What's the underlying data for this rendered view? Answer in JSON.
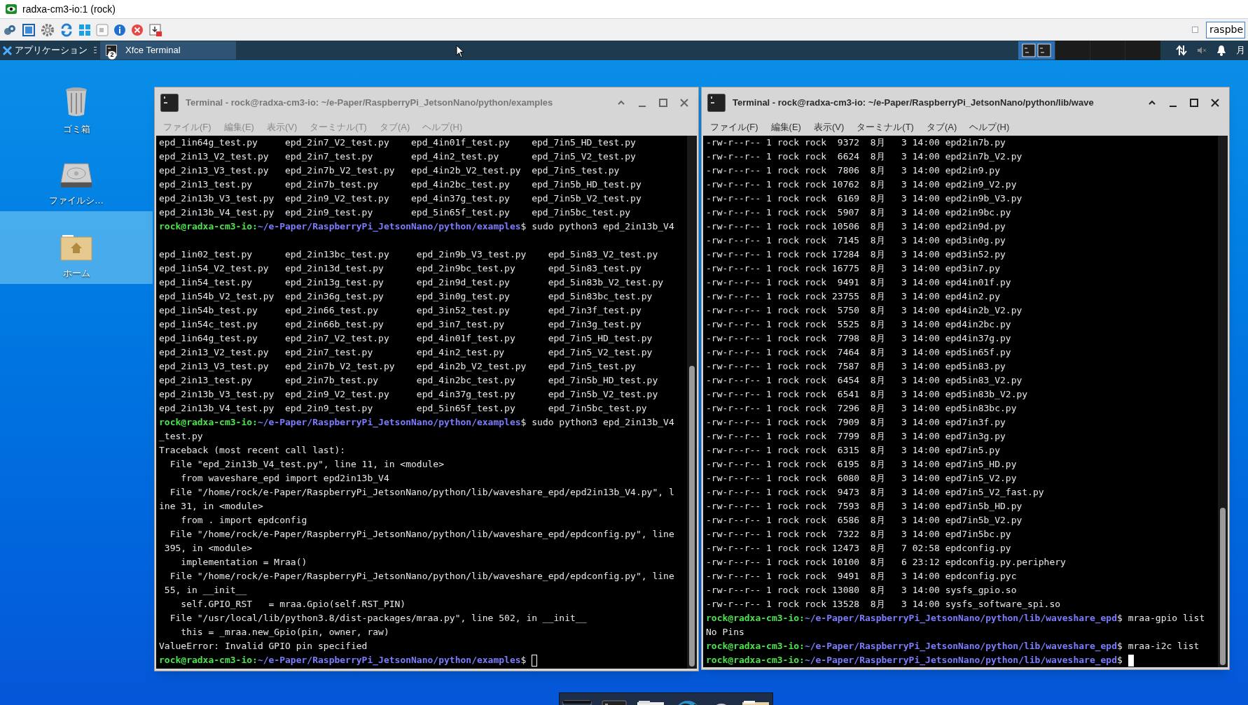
{
  "app_window": {
    "title": "radxa-cm3-io:1 (rock)"
  },
  "toolbar": {
    "field_value": "raspbe"
  },
  "panel": {
    "menu_label": "アプリケーション",
    "task": {
      "label": "Xfce Terminal",
      "badge": "2"
    },
    "clock": "月"
  },
  "desktop_icons": [
    {
      "label": "ゴミ箱",
      "kind": "trash",
      "selected": false
    },
    {
      "label": "ファイルシ…",
      "kind": "drive",
      "selected": false
    },
    {
      "label": "ホーム",
      "kind": "home",
      "selected": true
    }
  ],
  "terminals": [
    {
      "title": "Terminal - rock@radxa-cm3-io: ~/e-Paper/RaspberryPi_JetsonNano/python/examples",
      "active": false,
      "menu": [
        "ファイル(F)",
        "編集(E)",
        "表示(V)",
        "ターミナル(T)",
        "タブ(A)",
        "ヘルプ(H)"
      ],
      "lines": [
        "epd_1in64g_test.py     epd_2in7_V2_test.py    epd_4in01f_test.py    epd_7in5_HD_test.py",
        "epd_2in13_V2_test.py   epd_2in7_test.py       epd_4in2_test.py      epd_7in5_V2_test.py",
        "epd_2in13_V3_test.py   epd_2in7b_V2_test.py   epd_4in2b_V2_test.py  epd_7in5_test.py",
        "epd_2in13_test.py      epd_2in7b_test.py      epd_4in2bc_test.py    epd_7in5b_HD_test.py",
        "epd_2in13b_V3_test.py  epd_2in9_V2_test.py    epd_4in37g_test.py    epd_7in5b_V2_test.py",
        "epd_2in13b_V4_test.py  epd_2in9_test.py       epd_5in65f_test.py    epd_7in5bc_test.py",
        {
          "kind": "prompt",
          "user": "rock@radxa-cm3-io:",
          "path": "~/e-Paper/RaspberryPi_JetsonNano/python/examples",
          "command": "$ sudo python3 epd_2in13b_V4",
          "cursor": false
        },
        {
          "kind": "blank"
        },
        "epd_1in02_test.py      epd_2in13bc_test.py     epd_2in9b_V3_test.py    epd_5in83_V2_test.py",
        "epd_1in54_V2_test.py   epd_2in13d_test.py      epd_2in9bc_test.py      epd_5in83_test.py",
        "epd_1in54_test.py      epd_2in13g_test.py      epd_2in9d_test.py       epd_5in83b_V2_test.py",
        "epd_1in54b_V2_test.py  epd_2in36g_test.py      epd_3in0g_test.py       epd_5in83bc_test.py",
        "epd_1in54b_test.py     epd_2in66_test.py       epd_3in52_test.py       epd_7in3f_test.py",
        "epd_1in54c_test.py     epd_2in66b_test.py      epd_3in7_test.py        epd_7in3g_test.py",
        "epd_1in64g_test.py     epd_2in7_V2_test.py     epd_4in01f_test.py      epd_7in5_HD_test.py",
        "epd_2in13_V2_test.py   epd_2in7_test.py        epd_4in2_test.py        epd_7in5_V2_test.py",
        "epd_2in13_V3_test.py   epd_2in7b_V2_test.py    epd_4in2b_V2_test.py    epd_7in5_test.py",
        "epd_2in13_test.py      epd_2in7b_test.py       epd_4in2bc_test.py      epd_7in5b_HD_test.py",
        "epd_2in13b_V3_test.py  epd_2in9_V2_test.py     epd_4in37g_test.py      epd_7in5b_V2_test.py",
        "epd_2in13b_V4_test.py  epd_2in9_test.py        epd_5in65f_test.py      epd_7in5bc_test.py",
        {
          "kind": "prompt",
          "user": "rock@radxa-cm3-io:",
          "path": "~/e-Paper/RaspberryPi_JetsonNano/python/examples",
          "command": "$ sudo python3 epd_2in13b_V4",
          "cursor": false
        },
        "_test.py",
        "Traceback (most recent call last):",
        "  File \"epd_2in13b_V4_test.py\", line 11, in <module>",
        "    from waveshare_epd import epd2in13b_V4",
        "  File \"/home/rock/e-Paper/RaspberryPi_JetsonNano/python/lib/waveshare_epd/epd2in13b_V4.py\", l",
        "ine 31, in <module>",
        "    from . import epdconfig",
        "  File \"/home/rock/e-Paper/RaspberryPi_JetsonNano/python/lib/waveshare_epd/epdconfig.py\", line",
        " 395, in <module>",
        "    implementation = Mraa()",
        "  File \"/home/rock/e-Paper/RaspberryPi_JetsonNano/python/lib/waveshare_epd/epdconfig.py\", line",
        " 55, in __init__",
        "    self.GPIO_RST   = mraa.Gpio(self.RST_PIN)",
        "  File \"/usr/local/lib/python3.8/dist-packages/mraa.py\", line 502, in __init__",
        "    this = _mraa.new_Gpio(pin, owner, raw)",
        "ValueError: Invalid GPIO pin specified",
        {
          "kind": "prompt",
          "user": "rock@radxa-cm3-io:",
          "path": "~/e-Paper/RaspberryPi_JetsonNano/python/examples",
          "command": "$ ",
          "cursor": true
        }
      ]
    },
    {
      "title": "Terminal - rock@radxa-cm3-io: ~/e-Paper/RaspberryPi_JetsonNano/python/lib/wave",
      "active": true,
      "menu": [
        "ファイル(F)",
        "編集(E)",
        "表示(V)",
        "ターミナル(T)",
        "タブ(A)",
        "ヘルプ(H)"
      ],
      "lines": [
        "-rw-r--r-- 1 rock rock  9372  8月   3 14:00 epd2in7b.py",
        "-rw-r--r-- 1 rock rock  6624  8月   3 14:00 epd2in7b_V2.py",
        "-rw-r--r-- 1 rock rock  7806  8月   3 14:00 epd2in9.py",
        "-rw-r--r-- 1 rock rock 10762  8月   3 14:00 epd2in9_V2.py",
        "-rw-r--r-- 1 rock rock  6169  8月   3 14:00 epd2in9b_V3.py",
        "-rw-r--r-- 1 rock rock  5907  8月   3 14:00 epd2in9bc.py",
        "-rw-r--r-- 1 rock rock 10506  8月   3 14:00 epd2in9d.py",
        "-rw-r--r-- 1 rock rock  7145  8月   3 14:00 epd3in0g.py",
        "-rw-r--r-- 1 rock rock 17284  8月   3 14:00 epd3in52.py",
        "-rw-r--r-- 1 rock rock 16775  8月   3 14:00 epd3in7.py",
        "-rw-r--r-- 1 rock rock  9491  8月   3 14:00 epd4in01f.py",
        "-rw-r--r-- 1 rock rock 23755  8月   3 14:00 epd4in2.py",
        "-rw-r--r-- 1 rock rock  5750  8月   3 14:00 epd4in2b_V2.py",
        "-rw-r--r-- 1 rock rock  5525  8月   3 14:00 epd4in2bc.py",
        "-rw-r--r-- 1 rock rock  7798  8月   3 14:00 epd4in37g.py",
        "-rw-r--r-- 1 rock rock  7464  8月   3 14:00 epd5in65f.py",
        "-rw-r--r-- 1 rock rock  7587  8月   3 14:00 epd5in83.py",
        "-rw-r--r-- 1 rock rock  6454  8月   3 14:00 epd5in83_V2.py",
        "-rw-r--r-- 1 rock rock  6541  8月   3 14:00 epd5in83b_V2.py",
        "-rw-r--r-- 1 rock rock  7296  8月   3 14:00 epd5in83bc.py",
        "-rw-r--r-- 1 rock rock  7909  8月   3 14:00 epd7in3f.py",
        "-rw-r--r-- 1 rock rock  7799  8月   3 14:00 epd7in3g.py",
        "-rw-r--r-- 1 rock rock  6315  8月   3 14:00 epd7in5.py",
        "-rw-r--r-- 1 rock rock  6195  8月   3 14:00 epd7in5_HD.py",
        "-rw-r--r-- 1 rock rock  6080  8月   3 14:00 epd7in5_V2.py",
        "-rw-r--r-- 1 rock rock  9473  8月   3 14:00 epd7in5_V2_fast.py",
        "-rw-r--r-- 1 rock rock  7593  8月   3 14:00 epd7in5b_HD.py",
        "-rw-r--r-- 1 rock rock  6586  8月   3 14:00 epd7in5b_V2.py",
        "-rw-r--r-- 1 rock rock  7322  8月   3 14:00 epd7in5bc.py",
        "-rw-r--r-- 1 rock rock 12473  8月   7 02:58 epdconfig.py",
        "-rw-r--r-- 1 rock rock 10100  8月   6 23:12 epdconfig.py.periphery",
        "-rw-r--r-- 1 rock rock  9491  8月   3 14:00 epdconfig.pyc",
        "-rw-r--r-- 1 rock rock 13080  8月   3 14:00 sysfs_gpio.so",
        "-rw-r--r-- 1 rock rock 13528  8月   3 14:00 sysfs_software_spi.so",
        {
          "kind": "prompt",
          "user": "rock@radxa-cm3-io:",
          "path": "~/e-Paper/RaspberryPi_JetsonNano/python/lib/waveshare_epd",
          "command": "$ mraa-gpio list",
          "cursor": false
        },
        "No Pins",
        {
          "kind": "prompt",
          "user": "rock@radxa-cm3-io:",
          "path": "~/e-Paper/RaspberryPi_JetsonNano/python/lib/waveshare_epd",
          "command": "$ mraa-i2c list",
          "cursor": false
        },
        {
          "kind": "prompt",
          "user": "rock@radxa-cm3-io:",
          "path": "~/e-Paper/RaspberryPi_JetsonNano/python/lib/waveshare_epd",
          "command": "$ ",
          "cursor": true
        }
      ]
    }
  ]
}
